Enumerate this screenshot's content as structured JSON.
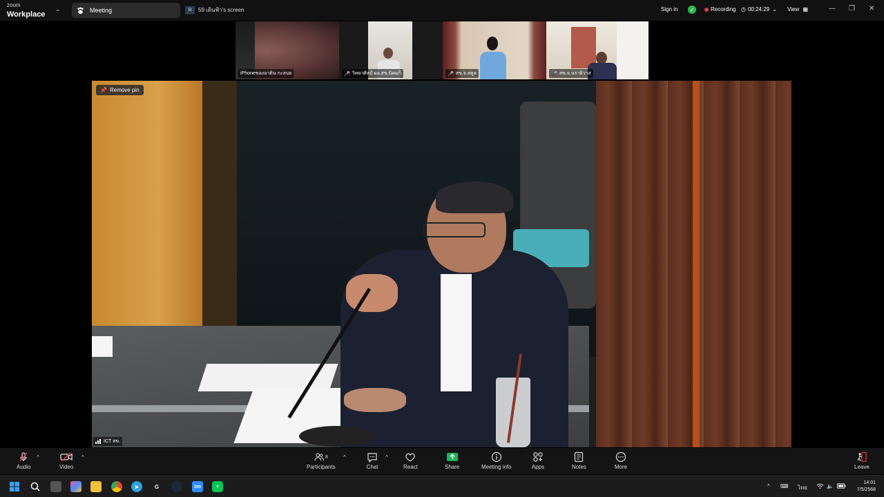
{
  "titlebar": {
    "brand_small": "zoom",
    "brand_big": "Workplace",
    "meeting_tab": "Meeting",
    "screen_badge": "5t",
    "screen_tab": "59 เดินฟ้า's screen",
    "sign_in": "Sign in",
    "recording": "Recording",
    "timer": "00:24:29",
    "view": "View"
  },
  "thumbnails": [
    {
      "label": "iPhoneของอาดิน กะลบย",
      "muted": false
    },
    {
      "label": "วิทยาศิลป์ ผอ.สข.นิคมก็",
      "muted": true
    },
    {
      "label": "สข.จ.สตูล",
      "muted": true
    },
    {
      "label": "สข.จ.นราธิวาส",
      "muted": true
    }
  ],
  "main_video": {
    "remove_pin": "Remove pin",
    "speaker_label": "ICT สข."
  },
  "toolbar": {
    "audio": "Audio",
    "video": "Video",
    "participants": "Participants",
    "participants_count": "8",
    "chat": "Chat",
    "react": "React",
    "share": "Share",
    "meeting_info": "Meeting info",
    "apps": "Apps",
    "notes": "Notes",
    "more": "More",
    "leave": "Leave"
  },
  "taskbar": {
    "zoom_icon_text": "zm",
    "language": "ไทย",
    "time": "14:01",
    "date": "7/5/2568"
  },
  "colors": {
    "accent_green": "#2eb84b",
    "recording_red": "#e23b3b",
    "share_green": "#1fb35a"
  }
}
